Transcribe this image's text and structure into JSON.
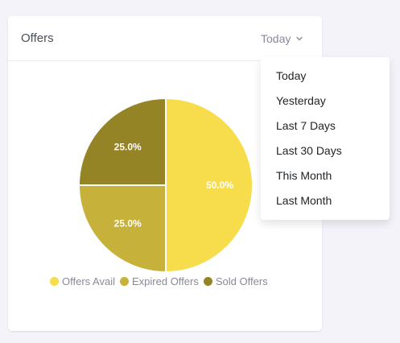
{
  "card": {
    "title": "Offers",
    "period_selected": "Today"
  },
  "dropdown": {
    "items": [
      "Today",
      "Yesterday",
      "Last 7 Days",
      "Last 30 Days",
      "This Month",
      "Last Month"
    ]
  },
  "colors": {
    "offers_avail": "#f7dd4b",
    "expired_offers": "#c6b23a",
    "sold_offers": "#958425"
  },
  "chart_data": {
    "type": "pie",
    "categories": [
      "Offers Avail",
      "Expired Offers",
      "Sold Offers"
    ],
    "values": [
      50,
      25,
      25
    ],
    "data_labels": [
      "50.0%",
      "25.0%",
      "25.0%"
    ],
    "legend_position": "bottom"
  }
}
